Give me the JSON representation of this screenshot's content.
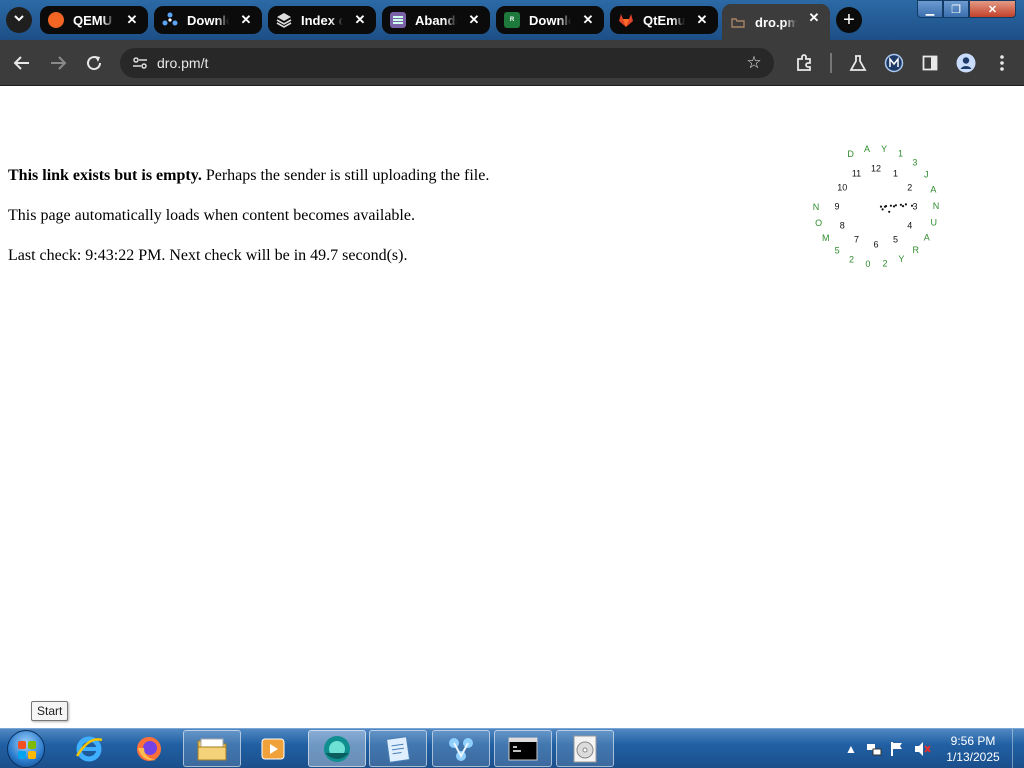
{
  "tabs": [
    {
      "title": "QEMU",
      "favicon": "qemu-icon",
      "color": "#f26522"
    },
    {
      "title": "Downlo",
      "favicon": "pinwheel-icon",
      "color": "#2d7cf6"
    },
    {
      "title": "Index of",
      "favicon": "stack-icon",
      "color": "#9aa0a6"
    },
    {
      "title": "Abando",
      "favicon": "abandonware-icon",
      "color": "#7b61a8"
    },
    {
      "title": "Downlo",
      "favicon": "roms-icon",
      "color": "#1e7a3c"
    },
    {
      "title": "QtEmu",
      "favicon": "gitlab-icon",
      "color": "#e24329"
    },
    {
      "title": "dro.pm",
      "favicon": "dropm-icon",
      "color": "#8a6a4a"
    }
  ],
  "address": {
    "url": "dro.pm/t"
  },
  "page": {
    "line1_bold": "This link exists but is empty.",
    "line1_rest": " Perhaps the sender is still uploading the file.",
    "line2": "This page automatically loads when content becomes available.",
    "line3": "Last check: 9:43:22 PM. Next check will be in 49.7 second(s)."
  },
  "clock": {
    "hour_numbers": [
      "12",
      "1",
      "2",
      "3",
      "4",
      "5",
      "6",
      "7",
      "8",
      "9",
      "10",
      "11"
    ],
    "outer_ring": [
      "D",
      "A",
      "Y",
      "1",
      "3",
      "J",
      "A",
      "N",
      "U",
      "A",
      "R",
      "Y",
      "2",
      "0",
      "2",
      "5",
      "M",
      "O",
      "N"
    ],
    "outer_color": "#2e8b2e",
    "inner_color": "#111111"
  },
  "tooltip": {
    "text": "Start"
  },
  "taskbar": {
    "time": "9:56 PM",
    "date": "1/13/2025"
  }
}
